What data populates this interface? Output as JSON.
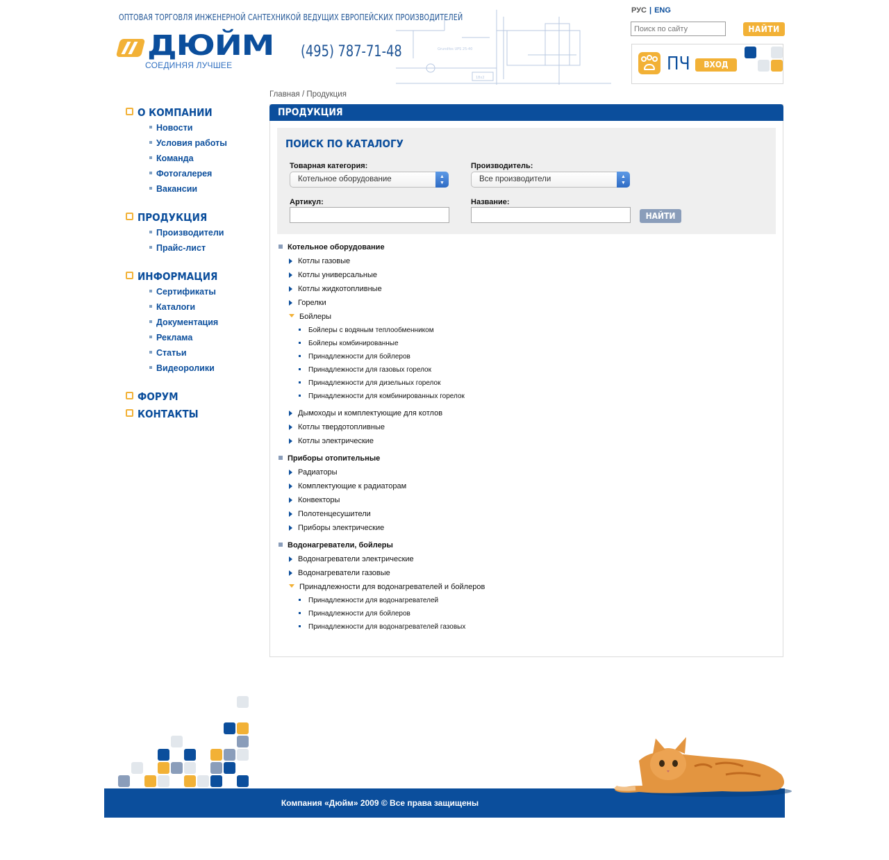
{
  "header": {
    "tagline": "ОПТОВАЯ ТОРГОВЛЯ ИНЖЕНЕРНОЙ САНТЕХНИКОЙ ВЕДУЩИХ ЕВРОПЕЙСКИХ ПРОИЗВОДИТЕЛЕЙ",
    "logo_text": "ДЮЙМ",
    "logo_slogan": "СОЕДИНЯЯ ЛУЧШЕЕ",
    "phone": "(495) 787-71-48",
    "schematic_labels": [
      "Grundfos UPS 25-40",
      "18x2"
    ],
    "lang": {
      "ru": "РУС",
      "separator": "|",
      "en": "ENG"
    },
    "site_search": {
      "placeholder": "Поиск по сайту",
      "button": "НАЙТИ"
    },
    "user": {
      "abbr": "ПЧ",
      "login_button": "ВХОД"
    }
  },
  "sidebar": {
    "sections": [
      {
        "title": "О КОМПАНИИ",
        "items": [
          "Новости",
          "Условия работы",
          "Команда",
          "Фотогалерея",
          "Вакансии"
        ]
      },
      {
        "title": "ПРОДУКЦИЯ",
        "items": [
          "Производители",
          "Прайс-лист"
        ]
      },
      {
        "title": "ИНФОРМАЦИЯ",
        "items": [
          "Сертификаты",
          "Каталоги",
          "Документация",
          "Реклама",
          "Статьи",
          "Видеоролики"
        ]
      },
      {
        "title": "ФОРУМ",
        "items": []
      },
      {
        "title": "КОНТАКТЫ",
        "items": []
      }
    ]
  },
  "breadcrumb": {
    "home": "Главная",
    "separator": "/",
    "current": "Продукция"
  },
  "main": {
    "title": "ПРОДУКЦИЯ",
    "catalog_search": {
      "title": "ПОИСК ПО КАТАЛОГУ",
      "category_label": "Товарная категория:",
      "category_value": "Котельное оборудование",
      "manufacturer_label": "Производитель:",
      "manufacturer_value": "Все производители",
      "article_label": "Артикул:",
      "name_label": "Название:",
      "button": "НАЙТИ"
    },
    "catalog": [
      {
        "title": "Котельное оборудование",
        "items": [
          {
            "label": "Котлы газовые",
            "open": false,
            "children": []
          },
          {
            "label": "Котлы универсальные",
            "open": false,
            "children": []
          },
          {
            "label": "Котлы жидкотопливные",
            "open": false,
            "children": []
          },
          {
            "label": "Горелки",
            "open": false,
            "children": []
          },
          {
            "label": "Бойлеры",
            "open": true,
            "children": [
              "Бойлеры с водяным теплообменником",
              "Бойлеры комбинированные",
              "Принадлежности для бойлеров",
              "Принадлежности для газовых горелок",
              "Принадлежности для дизельных горелок",
              "Принадлежности для комбинированных горелок"
            ]
          },
          {
            "label": "Дымоходы и комплектующие для котлов",
            "open": false,
            "children": []
          },
          {
            "label": "Котлы твердотопливные",
            "open": false,
            "children": []
          },
          {
            "label": "Котлы электрические",
            "open": false,
            "children": []
          }
        ]
      },
      {
        "title": "Приборы отопительные",
        "items": [
          {
            "label": "Радиаторы",
            "open": false,
            "children": []
          },
          {
            "label": "Комплектующие к радиаторам",
            "open": false,
            "children": []
          },
          {
            "label": "Конвекторы",
            "open": false,
            "children": []
          },
          {
            "label": "Полотенцесушители",
            "open": false,
            "children": []
          },
          {
            "label": "Приборы электрические",
            "open": false,
            "children": []
          }
        ]
      },
      {
        "title": "Водонагреватели, бойлеры",
        "items": [
          {
            "label": "Водонагреватели электрические",
            "open": false,
            "children": []
          },
          {
            "label": "Водонагреватели газовые",
            "open": false,
            "children": []
          },
          {
            "label": "Принадлежности для водонагревателей и бойлеров",
            "open": true,
            "children": [
              "Принадлежности для водонагревателей",
              "Принадлежности для бойлеров",
              "Принадлежности для водонагревателей газовых"
            ]
          }
        ]
      }
    ]
  },
  "footer": {
    "copyright": "Компания «Дюйм» 2009 © Все права защищены"
  },
  "colors": {
    "brand_blue": "#0b4e9c",
    "accent_orange": "#f2b136",
    "muted_blue": "#8a9dba",
    "light_gray": "#e2e7ec"
  },
  "icons": {
    "user": "people-icon",
    "bullet_open": "triangle-down-icon",
    "bullet_closed": "triangle-right-icon"
  }
}
